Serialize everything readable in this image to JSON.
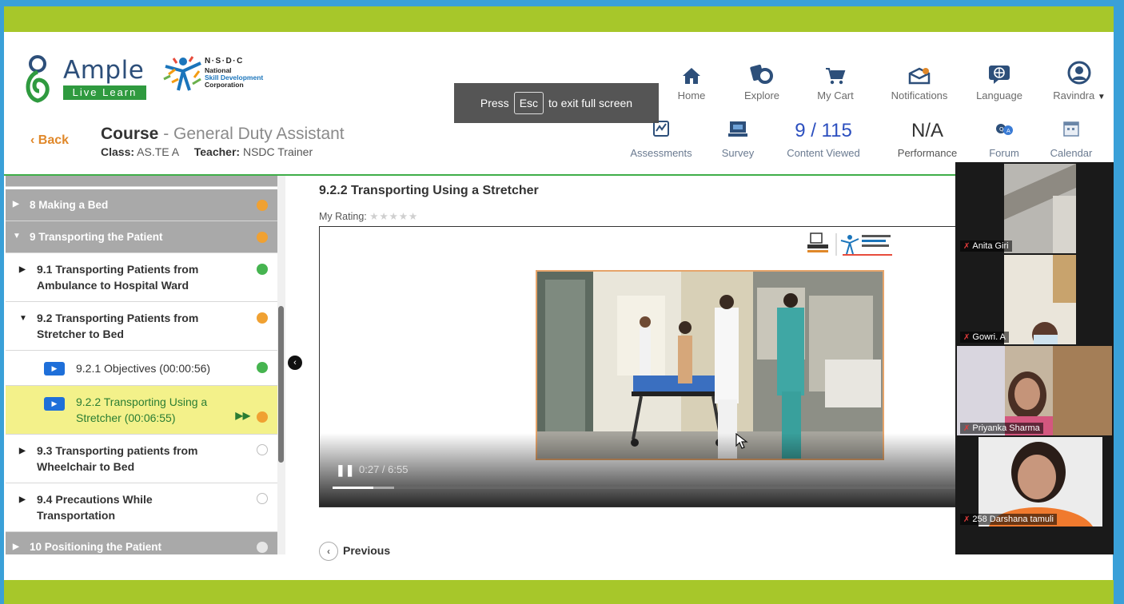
{
  "app": {
    "brand": "Ample",
    "brand_sub": "Live Learn",
    "partner_title": "N·S·D·C",
    "partner_lines": [
      "National",
      "Skill Development",
      "Corporation"
    ]
  },
  "nav": {
    "items": [
      {
        "label": "Home",
        "icon": "home-icon"
      },
      {
        "label": "Explore",
        "icon": "explore-icon"
      },
      {
        "label": "My Cart",
        "icon": "cart-icon"
      },
      {
        "label": "Notifications",
        "icon": "notifications-icon"
      },
      {
        "label": "Language",
        "icon": "language-icon"
      },
      {
        "label": "Ravindra",
        "icon": "user-avatar-icon"
      }
    ]
  },
  "toast": {
    "prefix": "Press",
    "key": "Esc",
    "suffix": "to exit full screen"
  },
  "course": {
    "back_label": "Back",
    "title_prefix": "Course",
    "title_sep": " - ",
    "title_name": "General Duty Assistant",
    "class_label": "Class:",
    "class_value": "AS.TE A",
    "teacher_label": "Teacher:",
    "teacher_value": "NSDC Trainer"
  },
  "stats": {
    "assessments_label": "Assessments",
    "survey_label": "Survey",
    "content_viewed_value": "9 / 115",
    "content_viewed_label": "Content Viewed",
    "performance_value": "N/A",
    "performance_label": "Performance",
    "forum_label": "Forum",
    "calendar_label": "Calendar"
  },
  "sidebar": {
    "items": [
      {
        "label": "8 Making a Bed",
        "status": "in-progress"
      },
      {
        "label": "9 Transporting the Patient",
        "status": "in-progress"
      },
      {
        "label": "9.1 Transporting Patients from Ambulance to Hospital Ward",
        "line1": "9.1 Transporting Patients from",
        "line2": "Ambulance to Hospital Ward",
        "status": "complete"
      },
      {
        "label": "9.2 Transporting Patients from Stretcher to Bed",
        "line1": "9.2 Transporting Patients from",
        "line2": "Stretcher to Bed",
        "status": "in-progress"
      },
      {
        "label": "9.2.1 Objectives (00:00:56)",
        "status": "complete"
      },
      {
        "label": "9.2.2 Transporting Using a Stretcher (00:06:55)",
        "line1": "9.2.2 Transporting Using a",
        "line2": "Stretcher (00:06:55)",
        "status": "in-progress"
      },
      {
        "label": "9.3 Transporting patients from Wheelchair to Bed",
        "line1": "9.3 Transporting patients from",
        "line2": "Wheelchair to Bed",
        "status": "not-started"
      },
      {
        "label": "9.4 Precautions While Transportation",
        "line1": "9.4 Precautions While",
        "line2": "Transportation",
        "status": "not-started"
      },
      {
        "label": "10 Positioning the Patient",
        "status": "not-started"
      }
    ],
    "colors": {
      "complete": "#46b450",
      "in_progress": "#f0a132",
      "not_started": "#bdbdbd"
    }
  },
  "lesson": {
    "title": "9.2.2 Transporting Using a Stretcher",
    "rating_label": "My Rating:",
    "stars": "★★★★★",
    "player": {
      "time": "0:27 / 6:55",
      "progress_fraction": 0.065,
      "buffered_fraction": 0.098
    },
    "previous_label": "Previous"
  },
  "participants": [
    {
      "name": "Anita Giri"
    },
    {
      "name": "Gowri. A"
    },
    {
      "name": "Priyanka Sharma"
    },
    {
      "name": "258 Darshana tamuli"
    }
  ],
  "colors": {
    "accent_bar": "#a7c72a",
    "frame": "#3aa0d8",
    "back": "#e0882a",
    "active_row": "#f3f18a"
  }
}
